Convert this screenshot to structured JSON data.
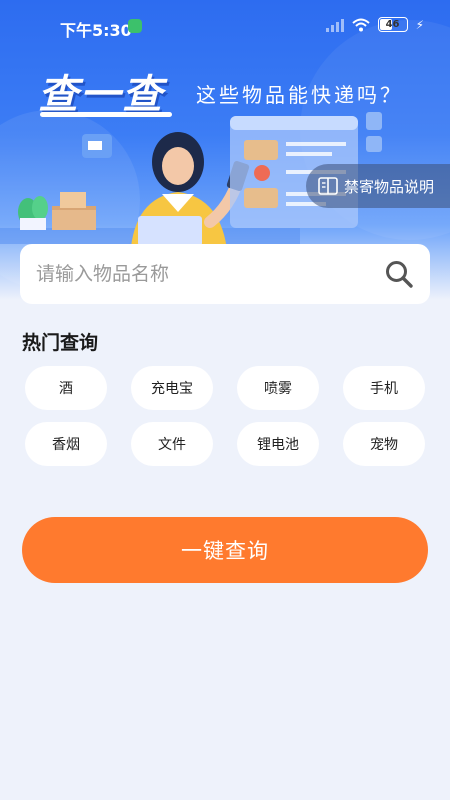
{
  "status_bar": {
    "time": "下午5:30",
    "battery": "46"
  },
  "hero": {
    "title": "查一查",
    "subtitle": "这些物品能快递吗？",
    "banned_button_label": "禁寄物品说明"
  },
  "search": {
    "placeholder": "请输入物品名称"
  },
  "hot": {
    "title": "热门查询",
    "items": [
      "酒",
      "充电宝",
      "喷雾",
      "手机",
      "香烟",
      "文件",
      "锂电池",
      "宠物"
    ]
  },
  "actions": {
    "query_label": "一键查询"
  },
  "colors": {
    "primary_blue": "#3c7df5",
    "accent_orange": "#ff7a2e",
    "background": "#eef2fb"
  }
}
